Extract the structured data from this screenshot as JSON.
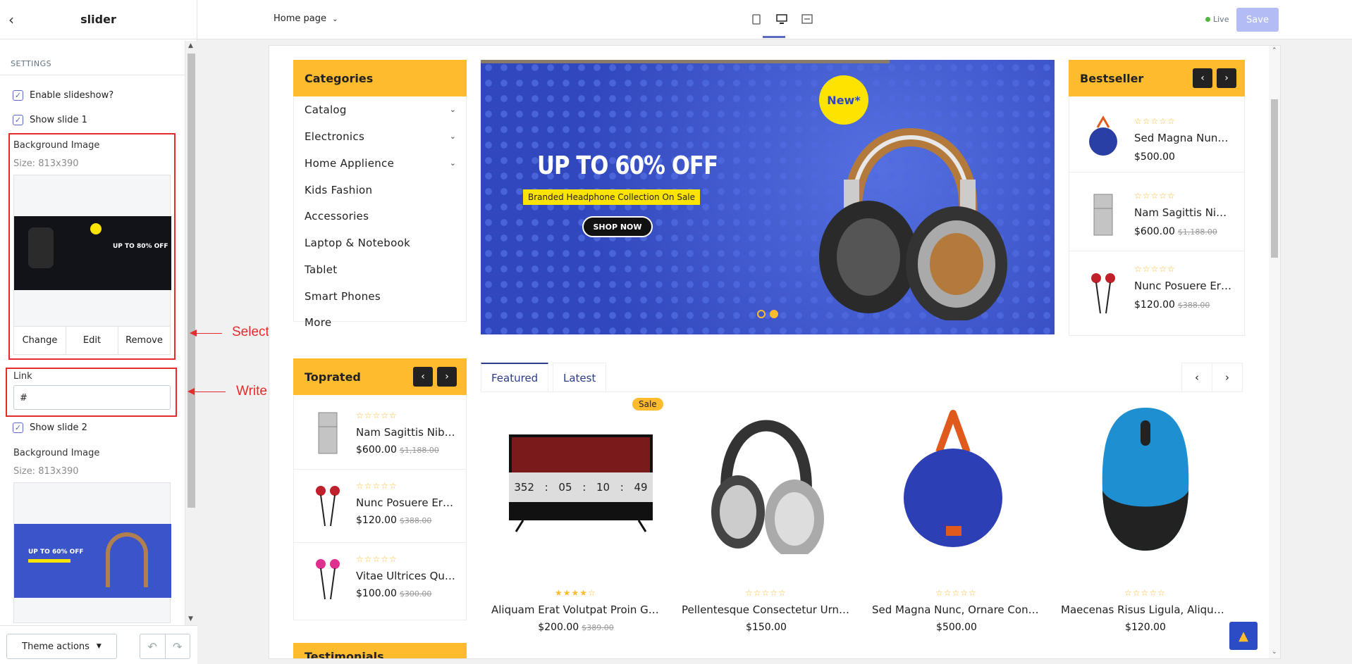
{
  "sidebar": {
    "title": "slider",
    "section": "SETTINGS",
    "enable_slideshow": "Enable slideshow?",
    "show_slide_1": "Show slide 1",
    "bg_image_label": "Background Image",
    "size_1": "Size: 813x390",
    "btn_change": "Change",
    "btn_edit": "Edit",
    "btn_remove": "Remove",
    "link_label": "Link",
    "link_value": "#",
    "show_slide_2": "Show slide 2",
    "bg_image_label_2": "Background Image",
    "size_2": "Size: 813x390",
    "thumb1_text": "UP TO 80% OFF",
    "thumb2_text": "UP TO 60% OFF",
    "theme_actions": "Theme actions"
  },
  "annotations": {
    "select_image": "Select image for slider",
    "write_link": "Write a link for slider"
  },
  "topbar": {
    "page_select": "Home page",
    "live": "Live",
    "save": "Save"
  },
  "store": {
    "categories_title": "Categories",
    "categories": [
      "Catalog",
      "Electronics",
      "Home Applience",
      "Kids Fashion",
      "Accessories",
      "Laptop & Notebook",
      "Tablet",
      "Smart Phones",
      "More"
    ],
    "banner": {
      "headline": "UP TO 60% OFF",
      "sub": "Branded Headphone Collection On Sale",
      "cta": "SHOP NOW",
      "badge": "New*"
    },
    "bestseller_title": "Bestseller",
    "bestseller": [
      {
        "name": "Sed Magna Nunc, Ornare Con...",
        "price": "$500.00",
        "old": ""
      },
      {
        "name": "Nam Sagittis Nibh Non...",
        "price": "$600.00",
        "old": "$1,188.00"
      },
      {
        "name": "Nunc Posuere Erat Ac...",
        "price": "$120.00",
        "old": "$388.00"
      }
    ],
    "toprated_title": "Toprated",
    "toprated": [
      {
        "name": "Nam Sagittis Nibh Non...",
        "price": "$600.00",
        "old": "$1,188.00"
      },
      {
        "name": "Nunc Posuere Erat Ac...",
        "price": "$120.00",
        "old": "$388.00"
      },
      {
        "name": "Vitae Ultrices Quam...",
        "price": "$100.00",
        "old": "$300.00"
      }
    ],
    "testimonials_title": "Testimonials",
    "tabs": [
      "Featured",
      "Latest"
    ],
    "countdown": [
      "352",
      "05",
      "10",
      "49"
    ],
    "sale_badge": "Sale",
    "products": [
      {
        "name": "Aliquam Erat Volutpat Proin Gravida",
        "price": "$200.00",
        "old": "$389.00",
        "rating": 4
      },
      {
        "name": "Pellentesque Consectetur Urna Nec",
        "price": "$150.00",
        "old": "",
        "rating": 0
      },
      {
        "name": "Sed Magna Nunc, Ornare Consequat",
        "price": "$500.00",
        "old": "",
        "rating": 0
      },
      {
        "name": "Maecenas Risus Ligula, Aliquam Nec",
        "price": "$120.00",
        "old": "",
        "rating": 0
      }
    ]
  },
  "colors": {
    "accent": "#fdbb2d",
    "primary": "#5c6ac4",
    "banner": "#3147bd"
  }
}
